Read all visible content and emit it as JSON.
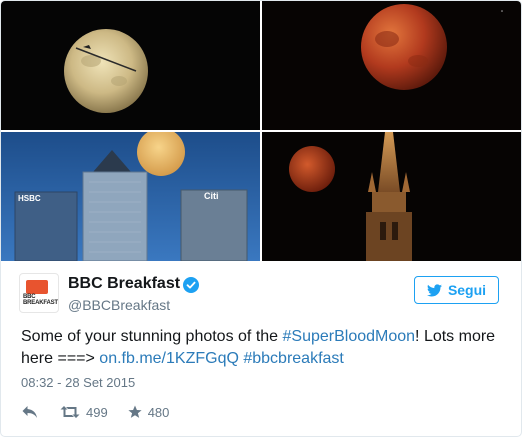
{
  "tweet": {
    "author": {
      "display_name": "BBC Breakfast",
      "handle": "@BBCBreakfast",
      "verified": true,
      "avatar_text": "BBC BREAKFAST"
    },
    "follow_label": "Segui",
    "text": {
      "intro": "Some of your stunning photos of the ",
      "hashtag1": "#SuperBloodMoon",
      "mid": "! Lots more here ===> ",
      "link": "on.fb.me/1KZFGqQ",
      "space": " ",
      "hashtag2": "#bbcbreakfast"
    },
    "timestamp": "08:32 - 28 Set 2015",
    "retweets": "499",
    "likes": "480",
    "photos": [
      {
        "icon": "full-moon-photo"
      },
      {
        "icon": "blood-moon-photo"
      },
      {
        "icon": "moon-over-skyscrapers-photo"
      },
      {
        "icon": "blood-moon-church-spire-photo"
      }
    ],
    "skyline_signs": [
      "HSBC",
      "Citi"
    ],
    "colors": {
      "accent": "#1da1f2",
      "link": "#2b7bb9",
      "muted": "#657786",
      "blood_moon": "#b23a1e",
      "bbc_red": "#e8542f"
    }
  }
}
